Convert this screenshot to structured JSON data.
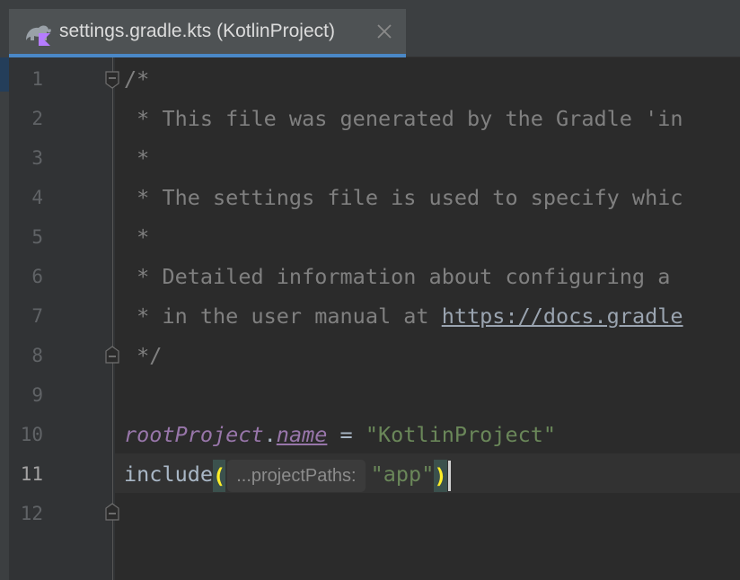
{
  "tab": {
    "title": "settings.gradle.kts (KotlinProject)",
    "file_icon": "gradle-kotlin-icon",
    "close_icon": "close-icon"
  },
  "editor": {
    "line_numbers": [
      "1",
      "2",
      "3",
      "4",
      "5",
      "6",
      "7",
      "8",
      "9",
      "10",
      "11",
      "12"
    ],
    "current_line": "11",
    "lines": {
      "l1": "/*",
      "l2": " * This file was generated by the Gradle 'in",
      "l3": " *",
      "l4": " * The settings file is used to specify whic",
      "l5": " *",
      "l6": " * Detailed information about configuring a ",
      "l7_prefix": " * in the user manual at ",
      "l7_link": "https://docs.gradle",
      "l8": " */",
      "l10_var": "rootProject",
      "l10_dot": ".",
      "l10_prop": "name",
      "l10_eq": " = ",
      "l10_str": "\"KotlinProject\"",
      "l11_kw": "include",
      "l11_open": "(",
      "l11_hint": "...projectPaths:",
      "l11_str": "\"app\"",
      "l11_close": ")"
    }
  },
  "colors": {
    "background": "#2b2b2b",
    "tab_accent": "#4a88c7",
    "comment": "#808080",
    "string": "#6a8759",
    "property": "#9876aa",
    "bracket_match": "#ffef28"
  }
}
